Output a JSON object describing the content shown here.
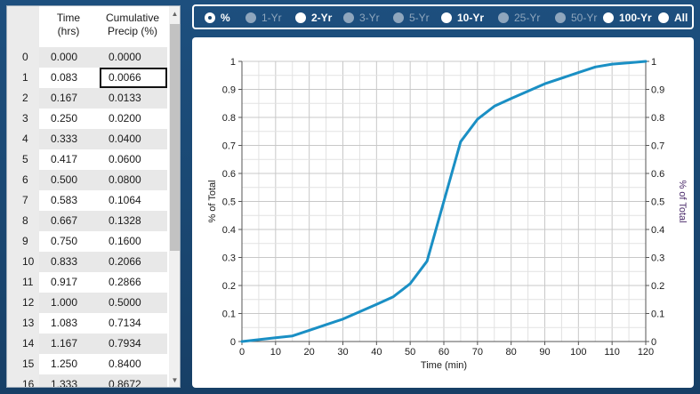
{
  "table": {
    "headers": {
      "time": [
        "Time",
        "(hrs)"
      ],
      "precip": [
        "Cumulative",
        "Precip (%)"
      ]
    },
    "rows": [
      {
        "idx": "0",
        "time": "0.000",
        "precip": "0.0000"
      },
      {
        "idx": "1",
        "time": "0.083",
        "precip": "0.0066"
      },
      {
        "idx": "2",
        "time": "0.167",
        "precip": "0.0133"
      },
      {
        "idx": "3",
        "time": "0.250",
        "precip": "0.0200"
      },
      {
        "idx": "4",
        "time": "0.333",
        "precip": "0.0400"
      },
      {
        "idx": "5",
        "time": "0.417",
        "precip": "0.0600"
      },
      {
        "idx": "6",
        "time": "0.500",
        "precip": "0.0800"
      },
      {
        "idx": "7",
        "time": "0.583",
        "precip": "0.1064"
      },
      {
        "idx": "8",
        "time": "0.667",
        "precip": "0.1328"
      },
      {
        "idx": "9",
        "time": "0.750",
        "precip": "0.1600"
      },
      {
        "idx": "10",
        "time": "0.833",
        "precip": "0.2066"
      },
      {
        "idx": "11",
        "time": "0.917",
        "precip": "0.2866"
      },
      {
        "idx": "12",
        "time": "1.000",
        "precip": "0.5000"
      },
      {
        "idx": "13",
        "time": "1.083",
        "precip": "0.7134"
      },
      {
        "idx": "14",
        "time": "1.167",
        "precip": "0.7934"
      },
      {
        "idx": "15",
        "time": "1.250",
        "precip": "0.8400"
      },
      {
        "idx": "16",
        "time": "1.333",
        "precip": "0.8672"
      }
    ],
    "selected_row": 1
  },
  "radios": [
    {
      "label": "%",
      "enabled": true,
      "checked": true
    },
    {
      "label": "1-Yr",
      "enabled": false,
      "checked": false
    },
    {
      "label": "2-Yr",
      "enabled": true,
      "checked": false
    },
    {
      "label": "3-Yr",
      "enabled": false,
      "checked": false
    },
    {
      "label": "5-Yr",
      "enabled": false,
      "checked": false
    },
    {
      "label": "10-Yr",
      "enabled": true,
      "checked": false
    },
    {
      "label": "25-Yr",
      "enabled": false,
      "checked": false
    },
    {
      "label": "50-Yr",
      "enabled": false,
      "checked": false
    },
    {
      "label": "100-Yr",
      "enabled": true,
      "checked": false
    },
    {
      "label": "All",
      "enabled": true,
      "checked": false
    }
  ],
  "icons": {
    "scroll_up": "scroll-up-arrow-icon",
    "scroll_down": "scroll-down-arrow-icon"
  },
  "colors": {
    "series": "#1a8fc4",
    "accent_bg": "#1a4873"
  },
  "chart_data": {
    "type": "line",
    "xlabel": "Time (min)",
    "ylabel": "% of Total",
    "ylabel_right": "% of Total",
    "xlim": [
      0,
      120
    ],
    "ylim": [
      0,
      1
    ],
    "x_ticks": [
      0,
      10,
      20,
      30,
      40,
      50,
      60,
      70,
      80,
      90,
      100,
      110,
      120
    ],
    "y_ticks": [
      0,
      0.1,
      0.2,
      0.3,
      0.4,
      0.5,
      0.6,
      0.7,
      0.8,
      0.9,
      1
    ],
    "y_tick_labels": [
      "0",
      "0.1",
      "0.2",
      "0.3",
      "0.4",
      "0.5",
      "0.6",
      "0.7",
      "0.8",
      "0.9",
      "1"
    ],
    "grid": true,
    "series": [
      {
        "x": [
          0,
          5,
          10,
          15,
          20,
          25,
          30,
          35,
          40,
          45,
          50,
          55,
          60,
          65,
          70,
          75,
          80,
          90,
          100,
          105,
          110,
          115,
          120
        ],
        "y": [
          0,
          0.0066,
          0.0133,
          0.02,
          0.04,
          0.06,
          0.08,
          0.1064,
          0.1328,
          0.16,
          0.2066,
          0.2866,
          0.5,
          0.7134,
          0.7934,
          0.84,
          0.8672,
          0.92,
          0.96,
          0.98,
          0.99,
          0.995,
          1.0
        ]
      }
    ]
  }
}
